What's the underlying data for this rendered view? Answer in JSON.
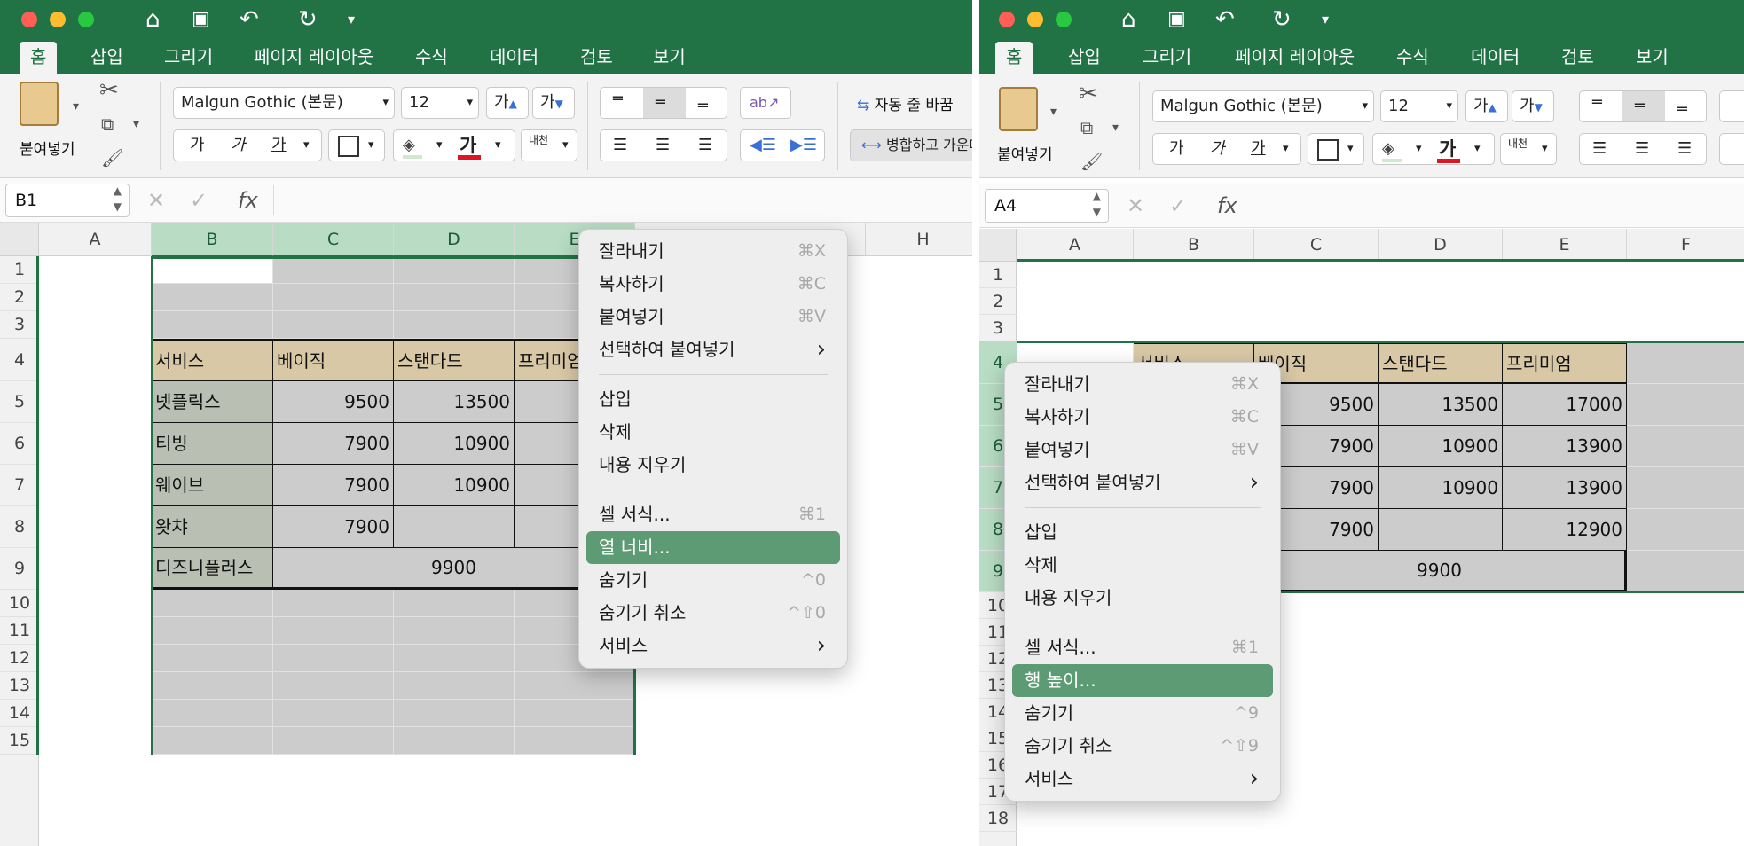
{
  "colors": {
    "accent": "#217346",
    "highlight": "#5d9b74",
    "table_header_fill": "#d8c8a6",
    "row_label_fill": "#b9bfb2",
    "cell_fill": "#cccccc"
  },
  "qat": {
    "icons": [
      "home-icon",
      "save-icon",
      "undo-icon",
      "redo-icon",
      "customize-icon"
    ]
  },
  "tabs": [
    "홈",
    "삽입",
    "그리기",
    "페이지 레이아웃",
    "수식",
    "데이터",
    "검토",
    "보기"
  ],
  "ribbon": {
    "paste_label": "붙여넣기",
    "font_name": "Malgun Gothic (본문)",
    "font_size": "12",
    "grow_font": "가",
    "shrink_font": "가",
    "bold": "가",
    "italic": "가",
    "underline": "가",
    "font_color": "가",
    "phonetic": "내천",
    "wrap_text": "자동 줄 바꿈",
    "merge": "병합하고 가운데 맞춤"
  },
  "left": {
    "namebox": "B1",
    "columns": [
      "A",
      "B",
      "C",
      "D",
      "E",
      "H"
    ],
    "rows": [
      "1",
      "2",
      "3",
      "4",
      "5",
      "6",
      "7",
      "8",
      "9",
      "10",
      "11",
      "12",
      "13",
      "14",
      "15"
    ],
    "table": {
      "header": [
        "서비스",
        "베이직",
        "스탠다드",
        "프리미엄"
      ],
      "body": [
        [
          "넷플릭스",
          "9500",
          "13500"
        ],
        [
          "티빙",
          "7900",
          "10900"
        ],
        [
          "웨이브",
          "7900",
          "10900"
        ],
        [
          "왓챠",
          "7900",
          ""
        ]
      ],
      "merged_label": "디즈니플러스",
      "merged_value": "9900"
    },
    "menu": [
      {
        "label": "잘라내기",
        "shortcut": "⌘X"
      },
      {
        "label": "복사하기",
        "shortcut": "⌘C"
      },
      {
        "label": "붙여넣기",
        "shortcut": "⌘V"
      },
      {
        "label": "선택하여 붙여넣기",
        "shortcut": "›"
      },
      {
        "sep": true
      },
      {
        "label": "삽입",
        "shortcut": ""
      },
      {
        "label": "삭제",
        "shortcut": ""
      },
      {
        "label": "내용 지우기",
        "shortcut": ""
      },
      {
        "sep": true
      },
      {
        "label": "셀 서식...",
        "shortcut": "⌘1"
      },
      {
        "label": "열 너비...",
        "shortcut": "",
        "highlighted": true
      },
      {
        "label": "숨기기",
        "shortcut": "^0"
      },
      {
        "label": "숨기기 취소",
        "shortcut": "^⇧0"
      },
      {
        "label": "서비스",
        "shortcut": "›"
      }
    ]
  },
  "right": {
    "namebox": "A4",
    "columns": [
      "A",
      "B",
      "C",
      "D",
      "E",
      "F"
    ],
    "rows": [
      "1",
      "2",
      "3",
      "4",
      "5",
      "6",
      "7",
      "8",
      "9",
      "10",
      "11",
      "12",
      "13",
      "14",
      "15",
      "16",
      "17",
      "18"
    ],
    "table": {
      "header": [
        "서비스",
        "베이직",
        "스탠다드",
        "프리미엄"
      ],
      "body": [
        [
          "9500",
          "13500",
          "17000"
        ],
        [
          "7900",
          "10900",
          "13900"
        ],
        [
          "7900",
          "10900",
          "13900"
        ],
        [
          "7900",
          "",
          "12900"
        ]
      ],
      "merged_value": "9900"
    },
    "menu": [
      {
        "label": "잘라내기",
        "shortcut": "⌘X"
      },
      {
        "label": "복사하기",
        "shortcut": "⌘C"
      },
      {
        "label": "붙여넣기",
        "shortcut": "⌘V"
      },
      {
        "label": "선택하여 붙여넣기",
        "shortcut": "›"
      },
      {
        "sep": true
      },
      {
        "label": "삽입",
        "shortcut": ""
      },
      {
        "label": "삭제",
        "shortcut": ""
      },
      {
        "label": "내용 지우기",
        "shortcut": ""
      },
      {
        "sep": true
      },
      {
        "label": "셀 서식...",
        "shortcut": "⌘1"
      },
      {
        "label": "행 높이...",
        "shortcut": "",
        "highlighted": true
      },
      {
        "label": "숨기기",
        "shortcut": "^9"
      },
      {
        "label": "숨기기 취소",
        "shortcut": "^⇧9"
      },
      {
        "label": "서비스",
        "shortcut": "›"
      }
    ]
  }
}
